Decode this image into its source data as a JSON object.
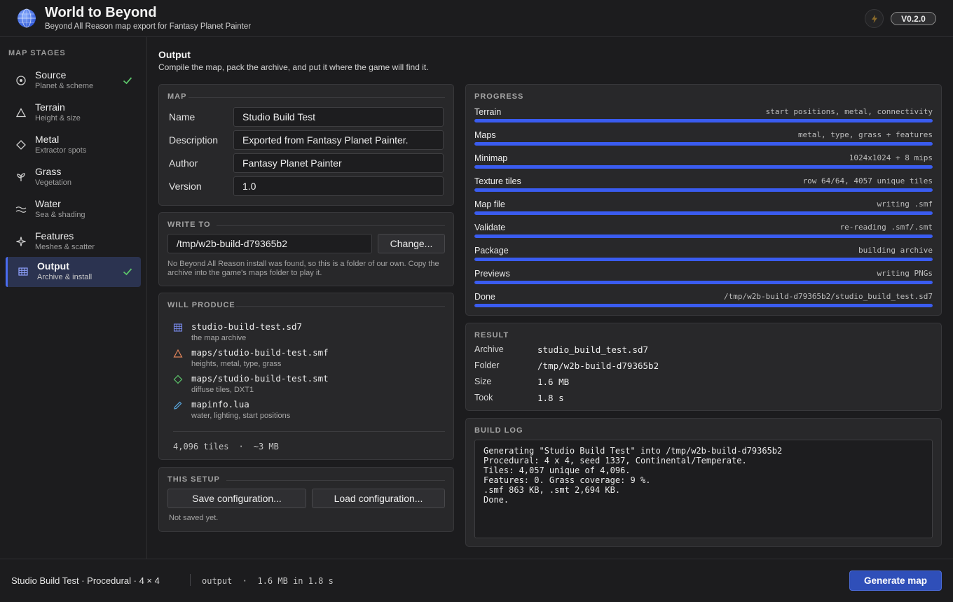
{
  "app": {
    "title": "World to Beyond",
    "subtitle": "Beyond All Reason map export for Fantasy Planet Painter",
    "version": "V0.2.0"
  },
  "sidebar": {
    "heading": "MAP STAGES",
    "items": [
      {
        "title": "Source",
        "sub": "Planet & scheme",
        "icon": "target-icon",
        "done": true,
        "active": false
      },
      {
        "title": "Terrain",
        "sub": "Height & size",
        "icon": "triangle-icon",
        "done": false,
        "active": false
      },
      {
        "title": "Metal",
        "sub": "Extractor spots",
        "icon": "diamond-icon",
        "done": false,
        "active": false
      },
      {
        "title": "Grass",
        "sub": "Vegetation",
        "icon": "sprout-icon",
        "done": false,
        "active": false
      },
      {
        "title": "Water",
        "sub": "Sea & shading",
        "icon": "waves-icon",
        "done": false,
        "active": false
      },
      {
        "title": "Features",
        "sub": "Meshes & scatter",
        "icon": "sparkle-icon",
        "done": false,
        "active": false
      },
      {
        "title": "Output",
        "sub": "Archive & install",
        "icon": "grid-icon",
        "done": true,
        "active": true
      }
    ]
  },
  "page": {
    "title": "Output",
    "description": "Compile the map, pack the archive, and put it where the game will find it."
  },
  "map_panel": {
    "heading": "MAP",
    "fields": [
      {
        "label": "Name",
        "value": "Studio Build Test"
      },
      {
        "label": "Description",
        "value": "Exported from Fantasy Planet Painter."
      },
      {
        "label": "Author",
        "value": "Fantasy Planet Painter"
      },
      {
        "label": "Version",
        "value": "1.0"
      }
    ]
  },
  "write_to": {
    "heading": "WRITE TO",
    "path": "/tmp/w2b-build-d79365b2",
    "change_label": "Change...",
    "note": "No Beyond All Reason install was found, so this is a folder of our own. Copy the archive into the game's maps folder to play it."
  },
  "will_produce": {
    "heading": "WILL PRODUCE",
    "files": [
      {
        "name": "studio-build-test.sd7",
        "desc": "the map archive",
        "icon": "grid-icon",
        "color": "#7a8cf0"
      },
      {
        "name": "maps/studio-build-test.smf",
        "desc": "heights, metal, type, grass",
        "icon": "triangle-icon",
        "color": "#e0845a"
      },
      {
        "name": "maps/studio-build-test.smt",
        "desc": "diffuse tiles, DXT1",
        "icon": "diamond-icon",
        "color": "#5cc46a"
      },
      {
        "name": "mapinfo.lua",
        "desc": "water, lighting, start positions",
        "icon": "pencil-icon",
        "color": "#5aa8e0"
      }
    ],
    "summary_tiles": "4,096 tiles",
    "summary_size": "~3 MB"
  },
  "this_setup": {
    "heading": "THIS SETUP",
    "save_label": "Save configuration...",
    "load_label": "Load configuration...",
    "status": "Not saved yet."
  },
  "progress": {
    "heading": "PROGRESS",
    "steps": [
      {
        "label": "Terrain",
        "status": "start positions, metal, connectivity",
        "fraction": 1.0
      },
      {
        "label": "Maps",
        "status": "metal, type, grass + features",
        "fraction": 1.0
      },
      {
        "label": "Minimap",
        "status": "1024x1024 + 8 mips",
        "fraction": 1.0
      },
      {
        "label": "Texture tiles",
        "status": "row 64/64, 4057 unique tiles",
        "fraction": 1.0
      },
      {
        "label": "Map file",
        "status": "writing .smf",
        "fraction": 1.0
      },
      {
        "label": "Validate",
        "status": "re-reading .smf/.smt",
        "fraction": 1.0
      },
      {
        "label": "Package",
        "status": "building archive",
        "fraction": 1.0
      },
      {
        "label": "Previews",
        "status": "writing PNGs",
        "fraction": 1.0
      },
      {
        "label": "Done",
        "status": "/tmp/w2b-build-d79365b2/studio_build_test.sd7",
        "fraction": 1.0
      }
    ]
  },
  "result": {
    "heading": "RESULT",
    "rows": [
      {
        "label": "Archive",
        "value": "studio_build_test.sd7"
      },
      {
        "label": "Folder",
        "value": "/tmp/w2b-build-d79365b2"
      },
      {
        "label": "Size",
        "value": "1.6 MB"
      },
      {
        "label": "Took",
        "value": "1.8 s"
      }
    ]
  },
  "build_log": {
    "heading": "BUILD LOG",
    "lines": [
      "Generating \"Studio Build Test\" into /tmp/w2b-build-d79365b2",
      "Procedural: 4 x 4, seed 1337, Continental/Temperate.",
      "Tiles: 4,057 unique of 4,096.",
      "Features: 0. Grass coverage: 9 %.",
      ".smf 863 KB, .smt 2,694 KB.",
      "Done."
    ]
  },
  "footer": {
    "summary": "Studio Build Test · Procedural · 4 × 4",
    "status": "output  ·  1.6 MB in 1.8 s",
    "generate_label": "Generate map"
  },
  "colors": {
    "accent": "#3a5cf0",
    "check": "#5cc46a"
  }
}
